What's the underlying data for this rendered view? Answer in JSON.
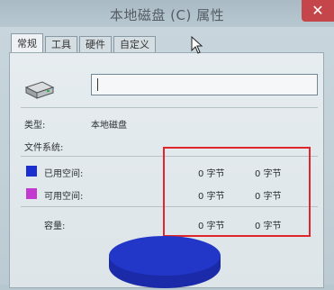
{
  "window": {
    "title": "本地磁盘 (C) 属性",
    "close_glyph": "✕"
  },
  "tabs": [
    {
      "label": "常规",
      "active": true
    },
    {
      "label": "工具",
      "active": false
    },
    {
      "label": "硬件",
      "active": false
    },
    {
      "label": "自定义",
      "active": false
    }
  ],
  "general": {
    "drive_name_value": "",
    "type_label": "类型:",
    "type_value": "本地磁盘",
    "filesystem_label": "文件系统:",
    "filesystem_value": "",
    "used_label": "已用空间:",
    "used_bytes": "0 字节",
    "used_size": "0 字节",
    "free_label": "可用空间:",
    "free_bytes": "0 字节",
    "free_size": "0 字节",
    "capacity_label": "容量:",
    "capacity_bytes": "0 字节",
    "capacity_size": "0 字节"
  },
  "colors": {
    "used_swatch": "#1b2fd0",
    "free_swatch": "#c23ad0",
    "pie_fill": "#2236c8",
    "highlight_box": "#e0262a",
    "close_button": "#c4464b"
  },
  "icons": {
    "drive": "hard-drive-icon",
    "cursor": "mouse-pointer-icon"
  }
}
